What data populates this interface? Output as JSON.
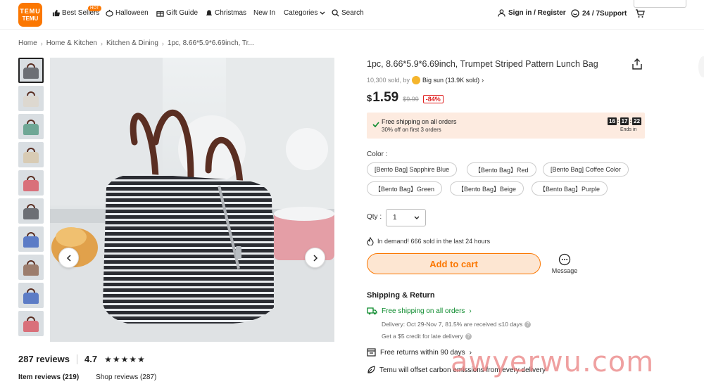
{
  "brand": {
    "logo_top": "TEMU",
    "logo_bottom": "TEMU"
  },
  "nav": {
    "best_sellers": "Best Sellers",
    "hot_badge": "HOT",
    "halloween": "Halloween",
    "gift_guide": "Gift Guide",
    "christmas": "Christmas",
    "new_in": "New In",
    "categories": "Categories",
    "search": "Search",
    "sign_in": "Sign in / Register",
    "support": "24 / 7Support"
  },
  "breadcrumb": [
    "Home",
    "Home & Kitchen",
    "Kitchen & Dining",
    "1pc, 8.66*5.9*6.69inch, Tr..."
  ],
  "product": {
    "title": "1pc, 8.66*5.9*6.69inch, Trumpet Striped Pattern Lunch Bag",
    "sold": "10,300 sold, by",
    "store": "Big sun (13.9K sold)",
    "currency": "$",
    "price": "1.59",
    "was_price": "$9.99",
    "discount": "-84%"
  },
  "promo": {
    "line1": "Free shipping on all orders",
    "line2": "30% off on first 3 orders",
    "timer": [
      "16",
      "17",
      "22"
    ],
    "ends": "Ends in"
  },
  "color": {
    "label": "Color :",
    "options": [
      "[Bento Bag] Sapphire Blue",
      "【Bento Bag】Red",
      "[Bento Bag] Coffee Color",
      "【Bento Bag】Green",
      "【Bento Bag】Beige",
      "【Bento Bag】Purple"
    ]
  },
  "quantity": {
    "label": "Qty :",
    "value": "1"
  },
  "demand": "In demand! 666 sold in the last 24 hours",
  "add_to_cart": "Add to cart",
  "message": "Message",
  "shipping": {
    "title": "Shipping & Return",
    "free": "Free shipping on all orders",
    "delivery": "Delivery: Oct 29-Nov 7, 81.5% are received ≤10 days",
    "credit": "Get a $5 credit for late delivery",
    "returns": "Free returns within 90 days",
    "carbon": "Temu will offset carbon emissions from every delivery"
  },
  "reviews": {
    "count": "287 reviews",
    "rating": "4.7",
    "stars": "★★★★★",
    "tab_item": "Item reviews (219)",
    "tab_shop": "Shop reviews (287)"
  },
  "watermark": "awyerwu.com",
  "colors": {
    "accent": "#fb7701",
    "green": "#0a8a2b",
    "promo_bg": "#fdebe0"
  },
  "thumb_colors": [
    "#6c6f75",
    "#ddd8d0",
    "#6fa795",
    "#d8cbb4",
    "#d9707a",
    "#6c6f75",
    "#5c7cc6",
    "#9c7d6d",
    "#5c7cc6",
    "#d9707a"
  ]
}
